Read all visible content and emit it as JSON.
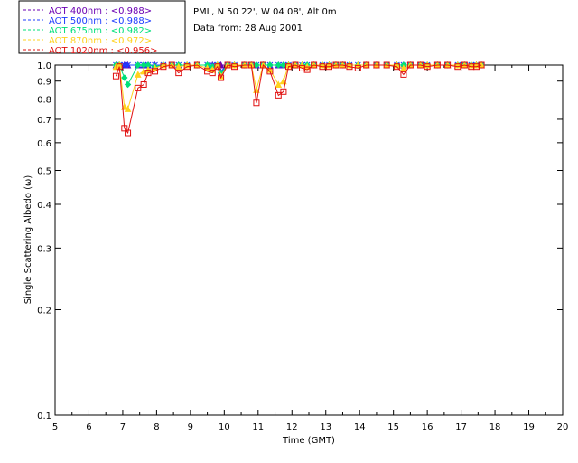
{
  "chart_data": {
    "type": "line",
    "info_lines": [
      "PML, N 50 22', W 04 08', Alt 0m",
      "Data from: 28 Aug 2001"
    ],
    "xlabel": "Time (GMT)",
    "ylabel": "Single Scattering Albedo (ω)",
    "xlim": [
      5,
      20
    ],
    "ylim": [
      0.1,
      1.0
    ],
    "yscale": "log",
    "x_ticks": [
      5,
      6,
      7,
      8,
      9,
      10,
      11,
      12,
      13,
      14,
      15,
      16,
      17,
      18,
      19,
      20
    ],
    "x_tick_labels": [
      "5",
      "6",
      "7",
      "8",
      "9",
      "10",
      "11",
      "12",
      "13",
      "14",
      "15",
      "16",
      "17",
      "18",
      "19",
      "20"
    ],
    "y_ticks": [
      0.1,
      0.2,
      0.3,
      0.4,
      0.5,
      0.6,
      0.7,
      0.8,
      0.9,
      1.0
    ],
    "y_tick_labels": [
      "0.1",
      "0.2",
      "0.3",
      "0.4",
      "0.5",
      "0.6",
      "0.7",
      "0.8",
      "0.9",
      "1.0"
    ],
    "legend_position": "top-left, outside plot",
    "x": [
      6.8,
      6.9,
      7.05,
      7.15,
      7.45,
      7.62,
      7.75,
      7.95,
      8.2,
      8.45,
      8.65,
      8.9,
      9.2,
      9.5,
      9.65,
      9.8,
      9.9,
      10.1,
      10.3,
      10.6,
      10.8,
      10.95,
      11.15,
      11.35,
      11.6,
      11.75,
      11.9,
      12.1,
      12.3,
      12.45,
      12.65,
      12.9,
      13.1,
      13.3,
      13.5,
      13.7,
      13.95,
      14.2,
      14.5,
      14.8,
      15.1,
      15.3,
      15.5,
      15.8,
      16.0,
      16.3,
      16.6,
      16.9,
      17.1,
      17.3,
      17.45,
      17.6
    ],
    "series": [
      {
        "name": "AOT  400nm : <0.988>",
        "color": "#6b00b3",
        "marker": "triangle",
        "values": [
          1,
          1,
          1,
          1,
          1,
          1,
          1,
          1,
          1,
          1,
          1,
          1,
          1,
          1,
          1,
          1,
          1,
          1,
          1,
          1,
          1,
          1,
          1,
          1,
          1,
          1,
          1,
          1,
          1,
          1,
          1,
          1,
          1,
          1,
          1,
          1,
          1,
          1,
          1,
          1,
          1,
          1,
          1,
          1,
          1,
          1,
          1,
          1,
          1,
          1,
          1,
          1
        ]
      },
      {
        "name": "AOT  500nm : <0.988>",
        "color": "#1e3cff",
        "marker": "asterisk",
        "values": [
          1,
          1,
          1,
          1,
          1,
          1,
          1,
          1,
          1,
          1,
          1,
          1,
          1,
          1,
          1,
          1,
          0.96,
          1,
          1,
          1,
          1,
          1,
          1,
          1,
          1,
          1,
          1,
          1,
          1,
          1,
          1,
          1,
          1,
          1,
          1,
          1,
          1,
          1,
          1,
          1,
          1,
          1,
          1,
          1,
          1,
          1,
          1,
          1,
          1,
          1,
          1,
          1
        ]
      },
      {
        "name": "AOT  675nm : <0.982>",
        "color": "#00e07a",
        "marker": "diamond",
        "values": [
          1,
          1,
          0.92,
          0.88,
          1,
          1,
          1,
          0.99,
          1,
          1,
          1,
          1,
          1,
          1,
          0.99,
          1,
          0.95,
          1,
          1,
          1,
          1,
          1,
          1,
          1,
          1,
          1,
          1,
          1,
          1,
          1,
          1,
          1,
          1,
          1,
          1,
          1,
          1,
          1,
          1,
          1,
          1,
          1,
          1,
          1,
          1,
          1,
          1,
          1,
          1,
          1,
          1,
          1
        ]
      },
      {
        "name": "AOT  870nm : <0.972>",
        "color": "#ffd21e",
        "marker": "triangle",
        "values": [
          0.99,
          1,
          0.76,
          0.75,
          0.94,
          0.96,
          0.97,
          0.98,
          1,
          1,
          0.99,
          1,
          1,
          0.98,
          0.97,
          1,
          0.93,
          1,
          1,
          1,
          1,
          0.85,
          1,
          0.97,
          0.88,
          0.9,
          1,
          1,
          1,
          0.99,
          1,
          1,
          1,
          1,
          1,
          1,
          1,
          1,
          1,
          1,
          1,
          0.98,
          1,
          1,
          1,
          1,
          1,
          1,
          1,
          1,
          1,
          1
        ]
      },
      {
        "name": "AOT 1020nm : <0.956>",
        "color": "#e01010",
        "marker": "square",
        "values": [
          0.93,
          0.99,
          0.66,
          0.64,
          0.86,
          0.88,
          0.95,
          0.96,
          0.99,
          1,
          0.95,
          0.99,
          1,
          0.96,
          0.95,
          0.99,
          0.92,
          1,
          0.99,
          1,
          1,
          0.78,
          1,
          0.96,
          0.82,
          0.84,
          0.99,
          1,
          0.98,
          0.97,
          1,
          0.99,
          0.99,
          1,
          1,
          0.99,
          0.98,
          1,
          1,
          1,
          0.99,
          0.94,
          1,
          1,
          0.99,
          1,
          1,
          0.99,
          1,
          0.99,
          0.99,
          1
        ]
      }
    ]
  }
}
